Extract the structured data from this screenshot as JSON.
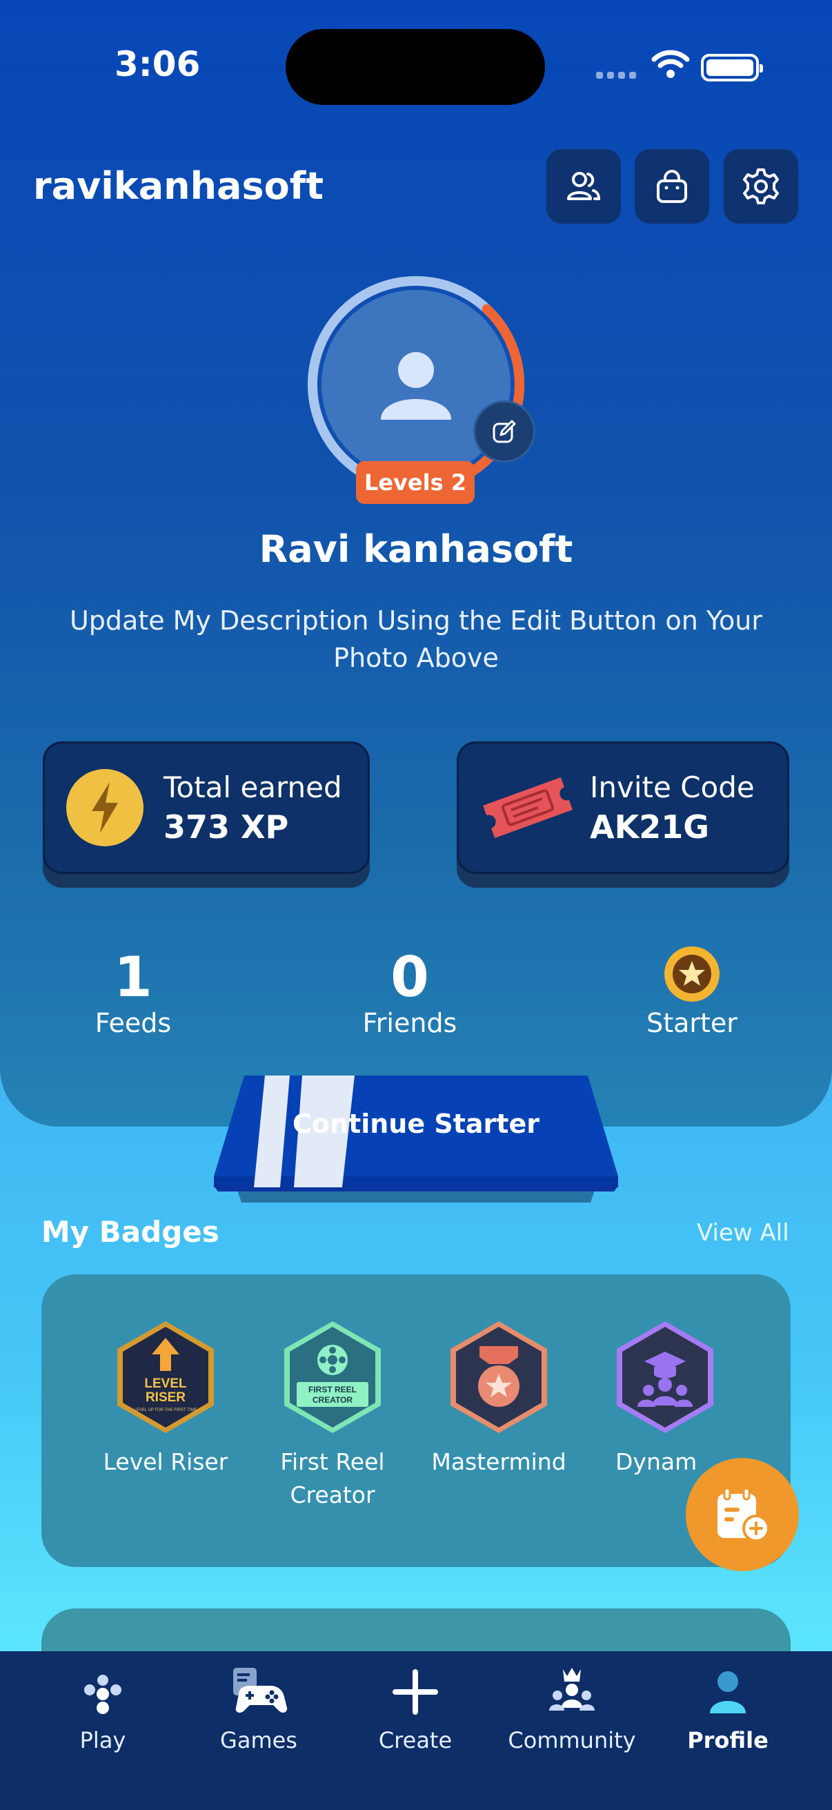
{
  "status_bar": {
    "time": "3:06"
  },
  "header": {
    "username": "ravikanhasoft"
  },
  "profile": {
    "level_label": "Levels 2",
    "display_name": "Ravi kanhasoft",
    "description": "Update My Description Using the Edit Button on Your Photo Above",
    "level_progress": 0.38
  },
  "cards": {
    "earned": {
      "label": "Total earned",
      "value": "373 XP"
    },
    "invite": {
      "label": "Invite Code",
      "value": "AK21G"
    }
  },
  "stats": {
    "feeds": {
      "value": "1",
      "label": "Feeds"
    },
    "friends": {
      "value": "0",
      "label": "Friends"
    },
    "starter": {
      "label": "Starter"
    }
  },
  "cta": {
    "label": "Continue Starter"
  },
  "badges": {
    "title": "My Badges",
    "view_all": "View All",
    "items": [
      {
        "name": "Level Riser",
        "art_text_1": "LEVEL",
        "art_text_2": "RISER",
        "art_text_3": "LEVEL UP FOR THE FIRST TIME"
      },
      {
        "name": "First Reel Creator",
        "art_text_1": "FIRST REEL",
        "art_text_2": "CREATOR"
      },
      {
        "name": "Mastermind"
      },
      {
        "name": "Dynam"
      }
    ]
  },
  "tabbar": {
    "items": [
      {
        "label": "Play"
      },
      {
        "label": "Games"
      },
      {
        "label": "Create"
      },
      {
        "label": "Community"
      },
      {
        "label": "Profile"
      }
    ]
  },
  "colors": {
    "accent_orange": "#ee6634",
    "card_bg": "#0d3168",
    "tabbar_bg": "#0d2e67",
    "fab": "#f0982c"
  }
}
